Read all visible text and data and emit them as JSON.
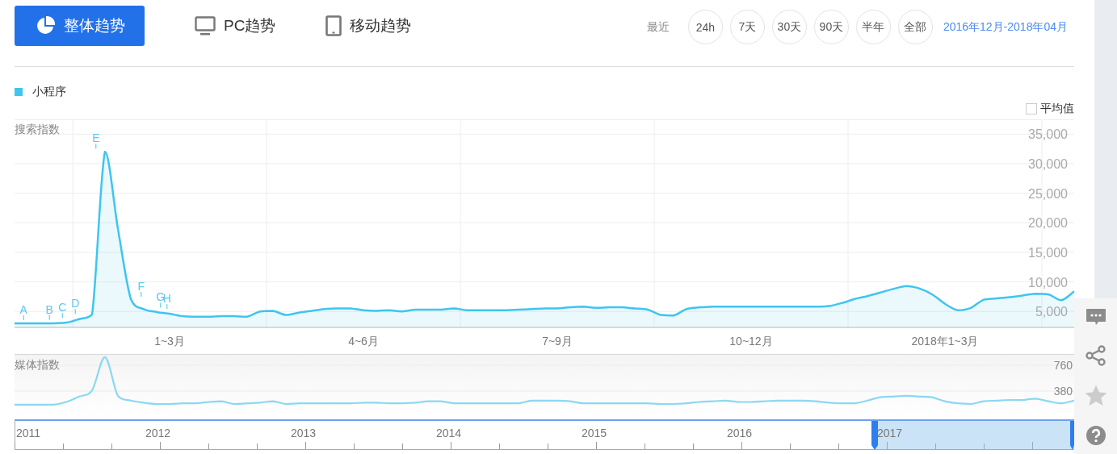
{
  "tabs": [
    {
      "label": "整体趋势",
      "kind": "overall",
      "selected": true
    },
    {
      "label": "PC趋势",
      "kind": "pc",
      "selected": false
    },
    {
      "label": "移动趋势",
      "kind": "mobile",
      "selected": false
    }
  ],
  "range": {
    "label": "最近",
    "options": [
      {
        "label": "24h",
        "selected": false
      },
      {
        "label": "7天",
        "selected": false
      },
      {
        "label": "30天",
        "selected": false
      },
      {
        "label": "90天",
        "selected": false
      },
      {
        "label": "半年",
        "selected": false
      },
      {
        "label": "全部",
        "selected": false
      }
    ],
    "custom": "2016年12月-2018年04月"
  },
  "legend": [
    {
      "name": "小程序",
      "color": "#3ec5f0"
    }
  ],
  "average": {
    "label": "平均值",
    "checked": false
  },
  "search_chart": {
    "chart_data": {
      "type": "area",
      "grid": true,
      "ylabel": "搜索指数",
      "ylim": [
        2300,
        37500
      ],
      "categories": [
        null,
        null,
        null,
        null,
        null,
        null,
        null,
        null,
        null,
        null,
        null,
        null,
        "1~3月",
        null,
        null,
        null,
        null,
        null,
        null,
        null,
        null,
        null,
        null,
        null,
        null,
        null,
        null,
        "4~6月",
        null,
        null,
        null,
        null,
        null,
        null,
        null,
        null,
        null,
        null,
        null,
        null,
        null,
        null,
        "7~9月",
        null,
        null,
        null,
        null,
        null,
        null,
        null,
        null,
        null,
        null,
        null,
        null,
        null,
        null,
        "10~12月",
        null,
        null,
        null,
        null,
        null,
        null,
        null,
        null,
        null,
        null,
        null,
        null,
        null,
        null,
        "2018年1~3月",
        null,
        null,
        null,
        null,
        null,
        null,
        null,
        null,
        null,
        null
      ],
      "series": [
        {
          "color": "#3ec5f0",
          "values": [
            3000,
            3000,
            3000,
            3000,
            3100,
            3700,
            4500,
            32000,
            19000,
            7100,
            5400,
            4900,
            4600,
            4200,
            4100,
            4100,
            4200,
            4200,
            4100,
            5000,
            5100,
            4400,
            4800,
            5100,
            5400,
            5500,
            5500,
            5200,
            5100,
            5200,
            5000,
            5300,
            5300,
            5300,
            5500,
            5200,
            5200,
            5200,
            5200,
            5300,
            5400,
            5500,
            5500,
            5700,
            5800,
            5600,
            5700,
            5700,
            5500,
            5300,
            4400,
            4300,
            5400,
            5700,
            5800,
            5800,
            5800,
            5800,
            5800,
            5800,
            5800,
            5800,
            5800,
            5900,
            6400,
            7100,
            7600,
            8200,
            8800,
            9300,
            8900,
            7900,
            6300,
            5200,
            5600,
            7000,
            7200,
            7400,
            7700,
            8000,
            7900,
            6900,
            8400
          ]
        }
      ],
      "yticks": [
        {
          "value": 5000,
          "label": "5,000"
        },
        {
          "value": 10000,
          "label": "10,000"
        },
        {
          "value": 15000,
          "label": "15,000"
        },
        {
          "value": 20000,
          "label": "20,000"
        },
        {
          "value": 25000,
          "label": "25,000"
        },
        {
          "value": 30000,
          "label": "30,000"
        },
        {
          "value": 35000,
          "label": "35,000"
        }
      ],
      "annotations": [
        "A",
        "B",
        "C",
        "D",
        "E",
        "F",
        "G",
        "H"
      ]
    }
  },
  "media_chart": {
    "chart_data": {
      "type": "line",
      "grid": true,
      "ylabel": "媒体指数",
      "ylim": [
        0,
        915
      ],
      "categories": [
        null,
        null,
        null,
        null,
        null,
        null,
        null,
        null,
        null,
        null,
        null,
        null,
        null,
        null,
        null,
        null,
        null,
        null,
        null,
        null,
        null,
        null,
        null,
        null,
        null,
        null,
        null,
        null,
        null,
        null,
        null,
        null,
        null,
        null,
        null,
        null,
        null,
        null,
        null,
        null,
        null,
        null,
        null,
        null,
        null,
        null,
        null,
        null,
        null,
        null,
        null,
        null,
        null,
        null,
        null,
        null,
        null,
        null,
        null,
        null,
        null,
        null,
        null,
        null,
        null,
        null,
        null,
        null,
        null,
        null,
        null,
        null,
        null,
        null,
        null,
        null,
        null,
        null,
        null,
        null,
        null,
        null,
        null
      ],
      "series": [
        {
          "color": "#8ad8f2",
          "values": [
            180,
            180,
            180,
            180,
            220,
            300,
            390,
            880,
            310,
            240,
            210,
            190,
            190,
            200,
            200,
            220,
            230,
            190,
            200,
            210,
            230,
            190,
            200,
            200,
            200,
            200,
            200,
            210,
            210,
            200,
            200,
            210,
            230,
            230,
            200,
            200,
            200,
            200,
            200,
            200,
            240,
            240,
            240,
            230,
            200,
            200,
            200,
            200,
            200,
            200,
            190,
            190,
            200,
            220,
            230,
            240,
            220,
            220,
            230,
            240,
            240,
            240,
            230,
            210,
            200,
            200,
            240,
            290,
            300,
            310,
            300,
            290,
            230,
            200,
            190,
            230,
            240,
            250,
            250,
            270,
            230,
            200,
            240
          ]
        }
      ],
      "yticks": [
        380,
        760
      ]
    }
  },
  "navigator": {
    "years": [
      "2011",
      "2012",
      "2013",
      "2014",
      "2015",
      "2016",
      "2017"
    ]
  }
}
